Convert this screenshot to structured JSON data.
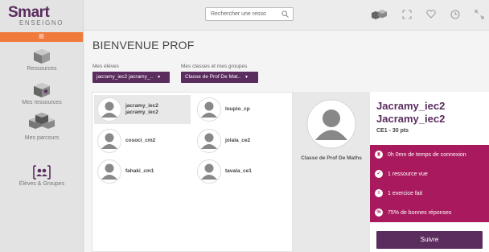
{
  "logo": {
    "main": "Smart",
    "sub": "ENSEIGNO"
  },
  "sidebar": {
    "menu_glyph": "≡",
    "items": [
      {
        "label": "Ressources",
        "icon": "cube-icon"
      },
      {
        "label": "Mes ressources",
        "icon": "star-cube-icon"
      },
      {
        "label": "Mes parcours",
        "icon": "cubes-icon"
      },
      {
        "label": "Élèves & Groupes",
        "icon": "group-icon"
      }
    ]
  },
  "search": {
    "placeholder": "Rechercher une resso"
  },
  "topbar": {
    "icons": [
      "cube-stack-icon",
      "fullscreen-icon",
      "heart-icon",
      "clock-icon",
      "expand-icon"
    ]
  },
  "main": {
    "title": "BIENVENUE PROF",
    "students_label": "Mes élèves",
    "students_select": "jacramy_iec2 jacramy_..",
    "classes_label": "Mes classes et mes groupes",
    "classes_select": "Classe de Prof De Mat.."
  },
  "students": [
    {
      "line1": "jacramy_iec2",
      "line2": "jacramy_iec2",
      "selected": true
    },
    {
      "line1": "loupio_cp",
      "line2": ""
    },
    {
      "line1": "cosoci_cm2",
      "line2": ""
    },
    {
      "line1": "jolala_ce2",
      "line2": ""
    },
    {
      "line1": "fahaki_cm1",
      "line2": ""
    },
    {
      "line1": "tavala_ce1",
      "line2": ""
    }
  ],
  "class_detail": {
    "name": "Classe de Prof De Maths"
  },
  "profile": {
    "name_line1": "Jacramy_iec2",
    "name_line2": "Jacramy_iec2",
    "class_points": "CE1 - 30 pts",
    "stats": [
      {
        "text": "0h 0mn de temps de connexion",
        "icon": "hourglass-icon",
        "glyph": "⧗"
      },
      {
        "text": "1 ressource vue",
        "icon": "check-icon",
        "glyph": "✓"
      },
      {
        "text": "1 exercice fait",
        "icon": "list-icon",
        "glyph": "≡"
      },
      {
        "text": "75% de bonnes réponses",
        "icon": "percent-icon",
        "glyph": "%"
      }
    ],
    "follow_label": "Suivre"
  },
  "colors": {
    "accent": "#5b2c5e",
    "magenta": "#a8195d",
    "orange": "#f07a3b"
  }
}
